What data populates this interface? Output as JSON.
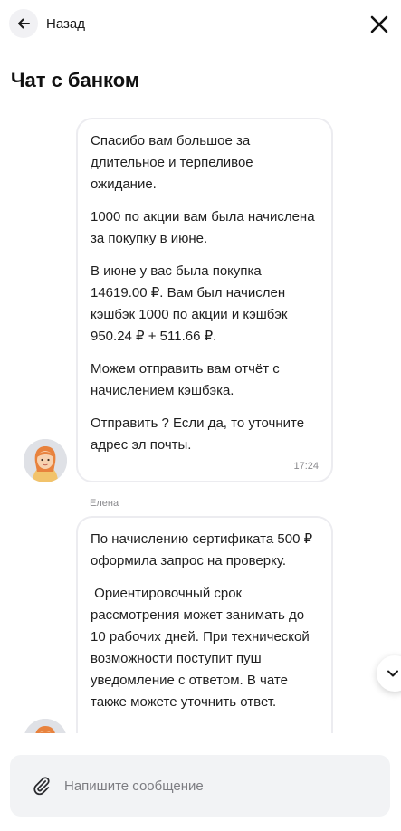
{
  "header": {
    "back_label": "Назад",
    "title": "Чат с банком"
  },
  "messages": [
    {
      "paragraphs": [
        "Спасибо вам большое за длительное и терпеливое ожидание.",
        "1000 по акции вам была начислена за покупку в июне.",
        "В июне у вас была покупка 14619.00 ₽. Вам был начислен кэшбэк 1000 по акции и кэшбэк 950.24 ₽ + 511.66 ₽.",
        "Можем отправить вам отчёт с начислением кэшбэка.",
        "Отправить ? Если да, то уточните адрес эл почты."
      ],
      "time": "17:24"
    },
    {
      "sender": "Елена",
      "paragraphs": [
        "По начислению сертификата 500 ₽ оформила запрос на проверку.",
        " Ориентировочный срок рассмотрения может занимать до 10 рабочих дней. При технической возможности поступит пуш уведомление с ответом. В чате также можете уточнить ответ."
      ]
    }
  ],
  "composer": {
    "placeholder": "Напишите сообщение"
  },
  "icons": {
    "back": "arrow-left-icon",
    "close": "close-icon",
    "attach": "paperclip-icon",
    "scroll": "chevron-down-icon"
  },
  "colors": {
    "bubble_border": "#ececf0",
    "input_background": "#f2f3f5",
    "muted_text": "#8a8a8e"
  }
}
